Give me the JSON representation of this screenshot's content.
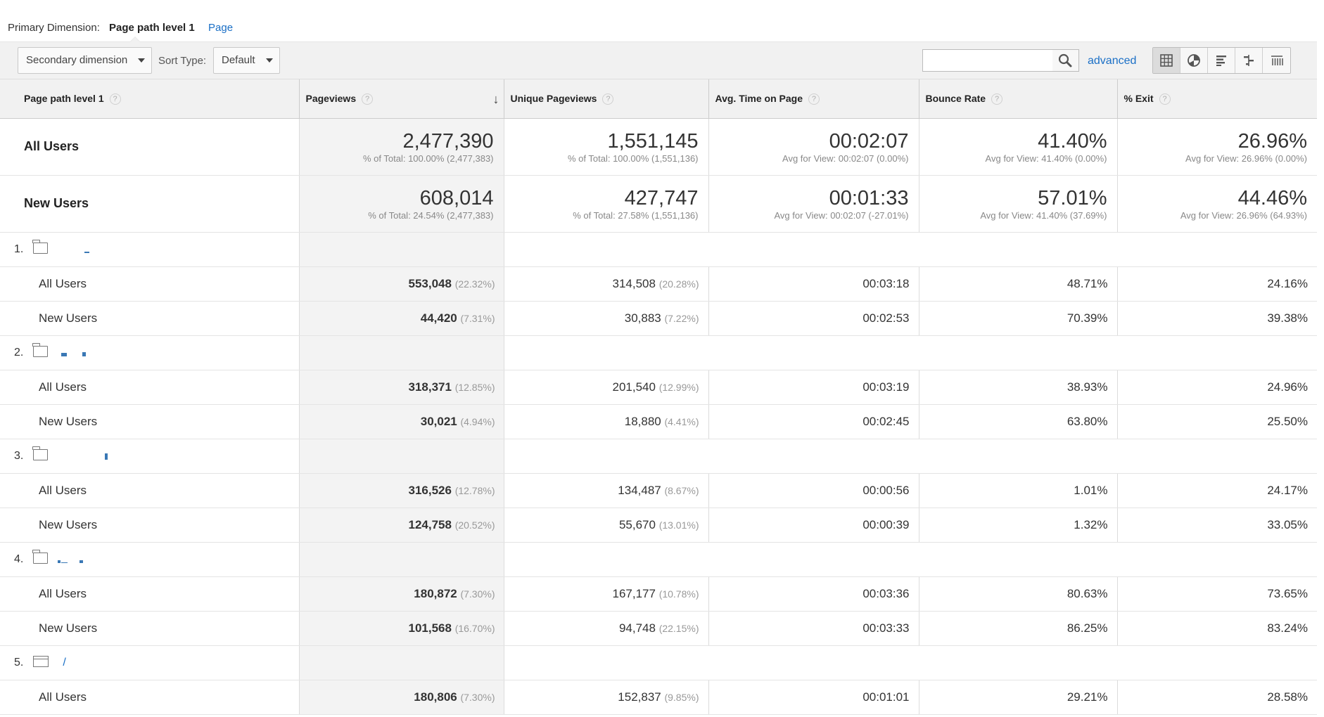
{
  "primary": {
    "label": "Primary Dimension:",
    "selected": "Page path level 1",
    "alternate": "Page"
  },
  "toolbar": {
    "secondary": "Secondary dimension",
    "sort_label": "Sort Type:",
    "sort_value": "Default",
    "search_placeholder": "",
    "advanced": "advanced"
  },
  "headers": {
    "c0": "Page path level 1",
    "c1": "Pageviews",
    "c2": "Unique Pageviews",
    "c3": "Avg. Time on Page",
    "c4": "Bounce Rate",
    "c5": "% Exit",
    "help": "?",
    "sort_arrow": "↓"
  },
  "totals": [
    {
      "label": "All Users",
      "pageviews": "2,477,390",
      "pageviews_sub": "% of Total: 100.00% (2,477,383)",
      "unique": "1,551,145",
      "unique_sub": "% of Total: 100.00% (1,551,136)",
      "time": "00:02:07",
      "time_sub": "Avg for View: 00:02:07 (0.00%)",
      "bounce": "41.40%",
      "bounce_sub": "Avg for View: 41.40% (0.00%)",
      "exit": "26.96%",
      "exit_sub": "Avg for View: 26.96% (0.00%)"
    },
    {
      "label": "New Users",
      "pageviews": "608,014",
      "pageviews_sub": "% of Total: 24.54% (2,477,383)",
      "unique": "427,747",
      "unique_sub": "% of Total: 27.58% (1,551,136)",
      "time": "00:01:33",
      "time_sub": "Avg for View: 00:02:07 (-27.01%)",
      "bounce": "57.01%",
      "bounce_sub": "Avg for View: 41.40% (37.69%)",
      "exit": "44.46%",
      "exit_sub": "Avg for View: 26.96% (64.93%)"
    }
  ],
  "groups": [
    {
      "num": "1.",
      "icon": "folder-icon",
      "path": "",
      "rows": [
        {
          "segment": "All Users",
          "pv": "553,048",
          "pv_pct": "(22.32%)",
          "upv": "314,508",
          "upv_pct": "(20.28%)",
          "time": "00:03:18",
          "bounce": "48.71%",
          "exit": "24.16%"
        },
        {
          "segment": "New Users",
          "pv": "44,420",
          "pv_pct": "(7.31%)",
          "upv": "30,883",
          "upv_pct": "(7.22%)",
          "time": "00:02:53",
          "bounce": "70.39%",
          "exit": "39.38%"
        }
      ]
    },
    {
      "num": "2.",
      "icon": "folder-icon",
      "path": "",
      "rows": [
        {
          "segment": "All Users",
          "pv": "318,371",
          "pv_pct": "(12.85%)",
          "upv": "201,540",
          "upv_pct": "(12.99%)",
          "time": "00:03:19",
          "bounce": "38.93%",
          "exit": "24.96%"
        },
        {
          "segment": "New Users",
          "pv": "30,021",
          "pv_pct": "(4.94%)",
          "upv": "18,880",
          "upv_pct": "(4.41%)",
          "time": "00:02:45",
          "bounce": "63.80%",
          "exit": "25.50%"
        }
      ]
    },
    {
      "num": "3.",
      "icon": "folder-icon",
      "path": "",
      "rows": [
        {
          "segment": "All Users",
          "pv": "316,526",
          "pv_pct": "(12.78%)",
          "upv": "134,487",
          "upv_pct": "(8.67%)",
          "time": "00:00:56",
          "bounce": "1.01%",
          "exit": "24.17%"
        },
        {
          "segment": "New Users",
          "pv": "124,758",
          "pv_pct": "(20.52%)",
          "upv": "55,670",
          "upv_pct": "(13.01%)",
          "time": "00:00:39",
          "bounce": "1.32%",
          "exit": "33.05%"
        }
      ]
    },
    {
      "num": "4.",
      "icon": "folder-icon",
      "path": "",
      "rows": [
        {
          "segment": "All Users",
          "pv": "180,872",
          "pv_pct": "(7.30%)",
          "upv": "167,177",
          "upv_pct": "(10.78%)",
          "time": "00:03:36",
          "bounce": "80.63%",
          "exit": "73.65%"
        },
        {
          "segment": "New Users",
          "pv": "101,568",
          "pv_pct": "(16.70%)",
          "upv": "94,748",
          "upv_pct": "(22.15%)",
          "time": "00:03:33",
          "bounce": "86.25%",
          "exit": "83.24%"
        }
      ]
    },
    {
      "num": "5.",
      "icon": "page-icon",
      "path": "/",
      "rows": [
        {
          "segment": "All Users",
          "pv": "180,806",
          "pv_pct": "(7.30%)",
          "upv": "152,837",
          "upv_pct": "(9.85%)",
          "time": "00:01:01",
          "bounce": "29.21%",
          "exit": "28.58%"
        }
      ]
    }
  ],
  "colors": {
    "link": "#1a6fc6",
    "redacted": "#3a78b5"
  }
}
